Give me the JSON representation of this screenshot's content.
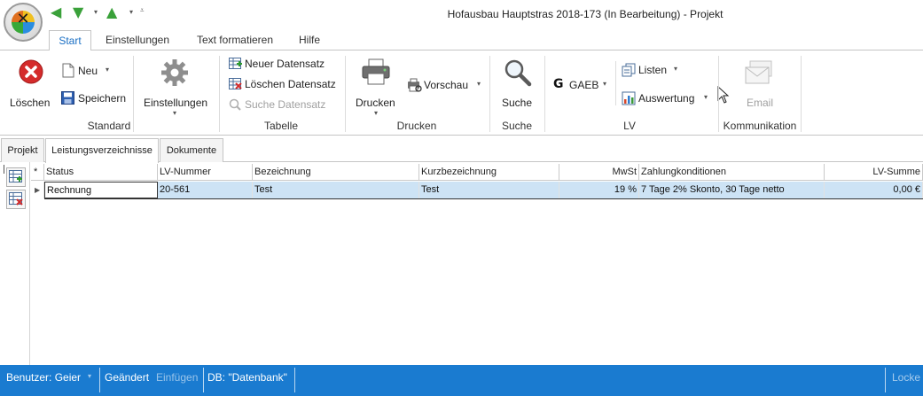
{
  "window": {
    "title": "Hofausbau Hauptstras 2018-173 (In Bearbeitung) - Projekt"
  },
  "ribbon_tabs": [
    "Start",
    "Einstellungen",
    "Text formatieren",
    "Hilfe"
  ],
  "ribbon": {
    "standard": {
      "label": "Standard",
      "loeschen": "Löschen",
      "neu": "Neu",
      "speichern": "Speichern",
      "einstellungen": "Einstellungen"
    },
    "tabelle": {
      "label": "Tabelle",
      "neuer": "Neuer Datensatz",
      "loeschen": "Löschen Datensatz",
      "suche": "Suche Datensatz"
    },
    "drucken": {
      "label": "Drucken",
      "drucken": "Drucken",
      "vorschau": "Vorschau"
    },
    "suche": {
      "label": "Suche",
      "suche": "Suche"
    },
    "lv": {
      "label": "LV",
      "gaeb": "GAEB",
      "listen": "Listen",
      "auswertung": "Auswertung"
    },
    "kommunikation": {
      "label": "Kommunikation",
      "email": "Email"
    }
  },
  "sub_tabs": [
    "Projekt",
    "Leistungsverzeichnisse",
    "Dokumente"
  ],
  "grid": {
    "headers": [
      "Status",
      "LV-Nummer",
      "Bezeichnung",
      "Kurzbezeichnung",
      "MwSt",
      "Zahlungkonditionen",
      "LV-Summe"
    ],
    "rows": [
      [
        "Rechnung",
        "20-561",
        "Test",
        "Test",
        "19 %",
        "7 Tage 2% Skonto, 30 Tage netto",
        "0,00 €"
      ]
    ]
  },
  "statusbar": {
    "user": "Benutzer: Geier",
    "changed": "Geändert",
    "insert": "Einfügen",
    "db": "DB: \"Datenbank\"",
    "lock": "Locke"
  },
  "colors": {
    "accent": "#1a7bd0",
    "row_selected": "#cde3f5",
    "active_tab": "#1a6fc4"
  },
  "icons": [
    "app-logo-icon",
    "back-arrow-icon",
    "down-arrow-icon",
    "up-arrow-icon",
    "delete-icon",
    "new-document-icon",
    "save-icon",
    "gear-icon",
    "new-record-icon",
    "delete-record-icon",
    "search-record-icon",
    "printer-icon",
    "preview-icon",
    "magnifier-icon",
    "gaeb-icon",
    "lists-icon",
    "evaluation-icon",
    "email-icon",
    "cursor-icon",
    "add-row-icon",
    "remove-row-icon"
  ]
}
